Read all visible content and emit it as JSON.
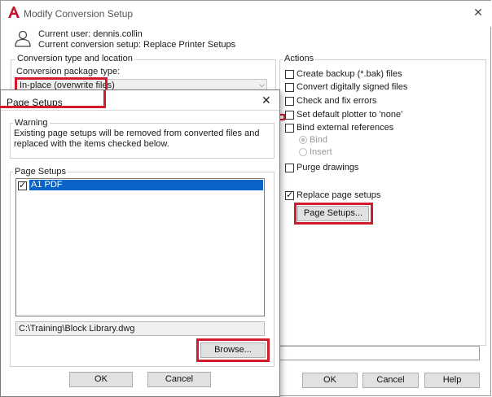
{
  "window": {
    "title": "Modify Conversion Setup",
    "close_glyph": "✕",
    "current_user": "Current user: dennis.collin",
    "current_setup": "Current conversion setup: Replace Printer Setups"
  },
  "conversion": {
    "group_label": "Conversion type and location",
    "package_type_label": "Conversion package type:",
    "package_type_value": "In-place (overwrite files)",
    "combo_arrow": "⌵"
  },
  "actions": {
    "group_label": "Actions",
    "items": [
      {
        "label": "Create backup (*.bak) files",
        "checked": false
      },
      {
        "label": "Convert digitally signed files",
        "checked": false
      },
      {
        "label": "Check and fix errors",
        "checked": false
      },
      {
        "label": "Set default plotter to 'none'",
        "checked": false
      },
      {
        "label": "Bind external references",
        "checked": false
      }
    ],
    "bind_options": [
      {
        "label": "Bind",
        "selected": true
      },
      {
        "label": "Insert",
        "selected": false
      }
    ],
    "purge_label": "Purge drawings",
    "replace_label": "Replace page setups",
    "page_setups_button": "Page Setups..."
  },
  "main_buttons": {
    "ok": "OK",
    "cancel": "Cancel",
    "help": "Help"
  },
  "page_setups_dialog": {
    "title": "Page Setups",
    "close_glyph": "✕",
    "warning_label": "Warning",
    "warning_text": "Existing page setups will be removed from converted files and replaced with the items checked below.",
    "list_label": "Page Setups",
    "list_items": [
      {
        "label": "A1 PDF",
        "checked": true
      }
    ],
    "file_path": "C:\\Training\\Block Library.dwg",
    "browse_button": "Browse...",
    "ok": "OK",
    "cancel": "Cancel"
  },
  "colors": {
    "highlight_red": "#d11c2d",
    "selection_blue": "#0a64c8",
    "app_logo_red": "#c8102e"
  }
}
